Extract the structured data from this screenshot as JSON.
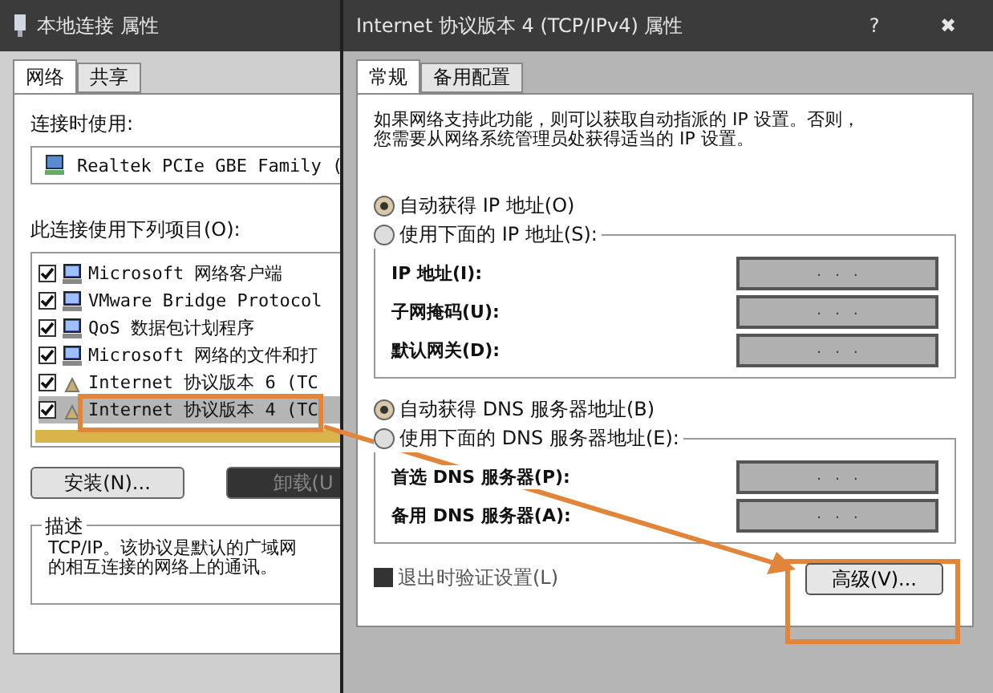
{
  "left_window": {
    "title": "本地连接 属性",
    "tabs": [
      {
        "label": "网络",
        "selected": true
      },
      {
        "label": "共享",
        "selected": false
      }
    ],
    "connect_using_label": "连接时使用:",
    "adapter": "Realtek PCIe GBE Family (",
    "items_label": "此连接使用下列项目(O):",
    "items": [
      {
        "label": "Microsoft 网络客户端",
        "checked": true,
        "selected": false,
        "kind": "computer"
      },
      {
        "label": "VMware Bridge Protocol",
        "checked": true,
        "selected": false,
        "kind": "computer"
      },
      {
        "label": "QoS 数据包计划程序",
        "checked": true,
        "selected": false,
        "kind": "computer"
      },
      {
        "label": "Microsoft 网络的文件和打",
        "checked": true,
        "selected": false,
        "kind": "computer"
      },
      {
        "label": "Internet 协议版本 6 (TC",
        "checked": true,
        "selected": false,
        "kind": "protocol"
      },
      {
        "label": "Internet 协议版本 4 (TC",
        "checked": true,
        "selected": true,
        "kind": "protocol"
      }
    ],
    "buttons": [
      {
        "label": "安装(N)...",
        "disabled": false
      },
      {
        "label": "卸载(U",
        "disabled": true
      }
    ],
    "description": {
      "title": "描述",
      "lines": [
        "TCP/IP。该协议是默认的广域网",
        "的相互连接的网络上的通讯。"
      ]
    }
  },
  "right_window": {
    "title": "Internet 协议版本 4 (TCP/IPv4) 属性",
    "help_button": "?",
    "close_button": "✖",
    "tabs": [
      {
        "label": "常规",
        "selected": true
      },
      {
        "label": "备用配置",
        "selected": false
      }
    ],
    "intro_lines": [
      "如果网络支持此功能，则可以获取自动指派的 IP 设置。否则，",
      "您需要从网络系统管理员处获得适当的 IP 设置。"
    ],
    "ip_radios": [
      {
        "label": "自动获得 IP 地址(O)",
        "selected": true
      },
      {
        "label": "使用下面的 IP 地址(S):",
        "selected": false
      }
    ],
    "ip_fields": [
      {
        "label": "IP 地址(I):",
        "value": ".   .   .",
        "disabled": true
      },
      {
        "label": "子网掩码(U):",
        "value": ".   .   .",
        "disabled": true
      },
      {
        "label": "默认网关(D):",
        "value": ".   .   .",
        "disabled": true
      }
    ],
    "dns_radios": [
      {
        "label": "自动获得 DNS 服务器地址(B)",
        "selected": true
      },
      {
        "label": "使用下面的 DNS 服务器地址(E):",
        "selected": false
      }
    ],
    "dns_fields": [
      {
        "label": "首选 DNS 服务器(P):",
        "value": ".   .   .",
        "disabled": true
      },
      {
        "label": "备用 DNS 服务器(A):",
        "value": ".   .   .",
        "disabled": true
      }
    ],
    "validate_checkbox": {
      "label": "退出时验证设置(L)",
      "checked": false
    },
    "advanced_button": "高级(V)..."
  }
}
